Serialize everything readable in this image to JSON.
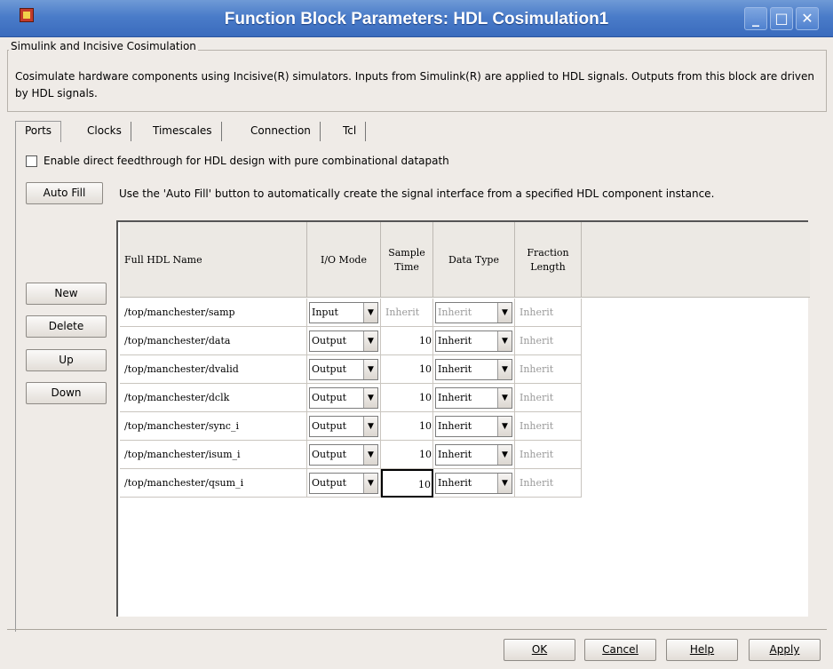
{
  "window": {
    "title": "Function Block Parameters: HDL Cosimulation1"
  },
  "group": {
    "legend": "Simulink and Incisive Cosimulation",
    "description": "Cosimulate hardware components using Incisive(R) simulators.  Inputs from Simulink(R) are applied to HDL signals.  Outputs from this block are driven by HDL signals."
  },
  "tabs": [
    {
      "label": "Ports",
      "active": true
    },
    {
      "label": "Clocks"
    },
    {
      "label": "Timescales"
    },
    {
      "label": "Connection"
    },
    {
      "label": "Tcl"
    }
  ],
  "feedthrough": {
    "label": "Enable direct feedthrough for HDL design with pure combinational datapath",
    "checked": false
  },
  "autofill": {
    "button": "Auto Fill",
    "help": "Use the 'Auto Fill' button to automatically create the signal interface from a specified HDL component instance."
  },
  "side_buttons": {
    "new": "New",
    "delete": "Delete",
    "up": "Up",
    "down": "Down"
  },
  "table": {
    "headers": {
      "name": "Full HDL Name",
      "mode": "I/O Mode",
      "sample1": "Sample",
      "sample2": "Time",
      "dtype": "Data Type",
      "frac1": "Fraction",
      "frac2": "Length"
    },
    "rows": [
      {
        "name": "/top/manchester/samp",
        "mode": "Input",
        "sample": "Inherit",
        "dtype": "Inherit",
        "frac": "Inherit"
      },
      {
        "name": "/top/manchester/data",
        "mode": "Output",
        "sample": "10",
        "dtype": "Inherit",
        "frac": "Inherit"
      },
      {
        "name": "/top/manchester/dvalid",
        "mode": "Output",
        "sample": "10",
        "dtype": "Inherit",
        "frac": "Inherit"
      },
      {
        "name": "/top/manchester/dclk",
        "mode": "Output",
        "sample": "10",
        "dtype": "Inherit",
        "frac": "Inherit"
      },
      {
        "name": "/top/manchester/sync_i",
        "mode": "Output",
        "sample": "10",
        "dtype": "Inherit",
        "frac": "Inherit"
      },
      {
        "name": "/top/manchester/isum_i",
        "mode": "Output",
        "sample": "10",
        "dtype": "Inherit",
        "frac": "Inherit"
      },
      {
        "name": "/top/manchester/qsum_i",
        "mode": "Output",
        "sample": "10",
        "dtype": "Inherit",
        "frac": "Inherit"
      }
    ]
  },
  "buttons": {
    "ok": "OK",
    "cancel": "Cancel",
    "help": "Help",
    "apply": "Apply"
  },
  "colors": {
    "titlebar": "#4a7cc9",
    "window_bg": "#efebe7"
  }
}
